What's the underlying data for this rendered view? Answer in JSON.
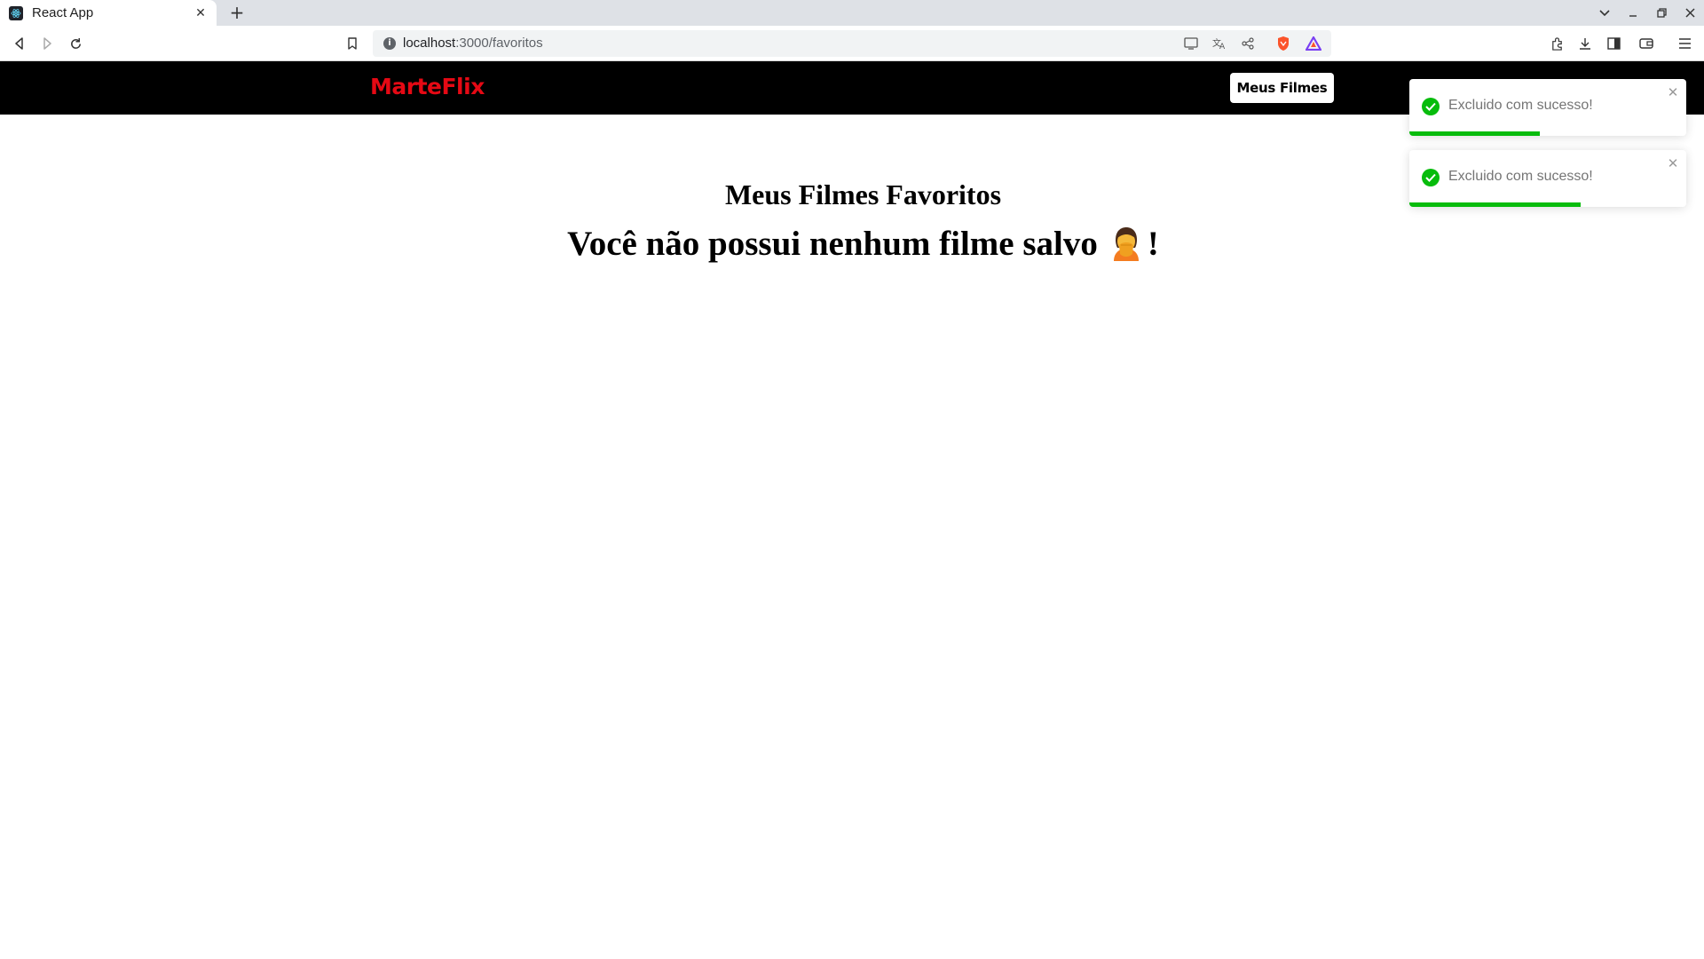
{
  "browser": {
    "tab_title": "React App",
    "tab_close_icon": "close-icon",
    "new_tab_icon": "plus-icon",
    "url_host": "localhost",
    "url_path": ":3000/favoritos"
  },
  "header": {
    "logo": "MarteFlix",
    "nav_button": "Meus Filmes"
  },
  "main": {
    "title": "Meus Filmes Favoritos",
    "empty_message": "Você não possui nenhum filme salvo",
    "empty_suffix": "!"
  },
  "toasts": [
    {
      "message": "Excluido com sucesso!",
      "progress": 0.47
    },
    {
      "message": "Excluido com sucesso!",
      "progress": 0.62
    }
  ],
  "colors": {
    "brand": "#e50914",
    "header_bg": "#000000",
    "success": "#07bc0c"
  }
}
